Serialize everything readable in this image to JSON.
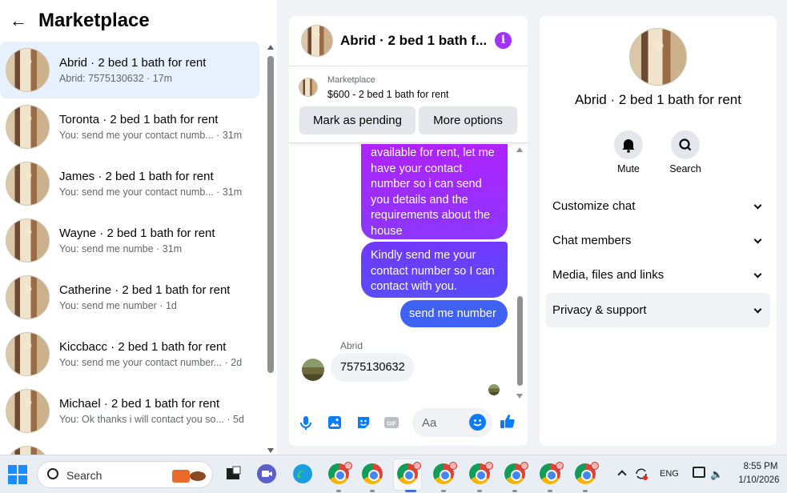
{
  "left_panel": {
    "title": "Marketplace",
    "conversations": [
      {
        "title": "Abrid · 2 bed 1 bath for rent",
        "preview": "Abrid: 7575130632 · 17m"
      },
      {
        "title": "Toronta · 2 bed 1 bath for rent",
        "preview": "You: send me your contact numb... · 31m"
      },
      {
        "title": "James · 2 bed 1 bath for rent",
        "preview": "You: send me your contact numb... · 31m"
      },
      {
        "title": "Wayne · 2 bed 1 bath for rent",
        "preview": "You: send me numbe · 31m"
      },
      {
        "title": "Catherine · 2 bed 1 bath for rent",
        "preview": "You: send me number · 1d"
      },
      {
        "title": "Kiccbacc · 2 bed 1 bath for rent",
        "preview": "You: send me your contact number... · 2d"
      },
      {
        "title": "Michael · 2 bed 1 bath for rent",
        "preview": "You: Ok thanks i will contact you so... · 5d"
      }
    ]
  },
  "chat": {
    "title": "Abrid · 2 bed 1 bath f...",
    "listing": {
      "source": "Marketplace",
      "item": "$600 - 2 bed 1 bath for rent"
    },
    "buttons": {
      "pending": "Mark as pending",
      "options": "More options"
    },
    "messages": {
      "m1": "available for rent, let me have your contact number so i can send you details and the requirements about the house",
      "m2": "Kindly send me your contact number so I can contact with you.",
      "m3": "send me number",
      "sender": "Abrid",
      "m4": "7575130632"
    },
    "composer": {
      "placeholder": "Aa"
    }
  },
  "right_panel": {
    "name": "Abrid · 2 bed 1 bath for rent",
    "actions": {
      "mute": "Mute",
      "search": "Search"
    },
    "rows": {
      "customize": "Customize chat",
      "members": "Chat members",
      "media": "Media, files and links",
      "privacy": "Privacy & support"
    }
  },
  "taskbar": {
    "search": "Search",
    "lang": "ENG",
    "time": "8:55 PM",
    "date": "1/10/2026"
  },
  "colors": {
    "accent": "#0a7cff",
    "selected_row": "#e7f1fd",
    "bubble_purple": "#a033ff",
    "bubble_blue": "#3f62f5"
  }
}
